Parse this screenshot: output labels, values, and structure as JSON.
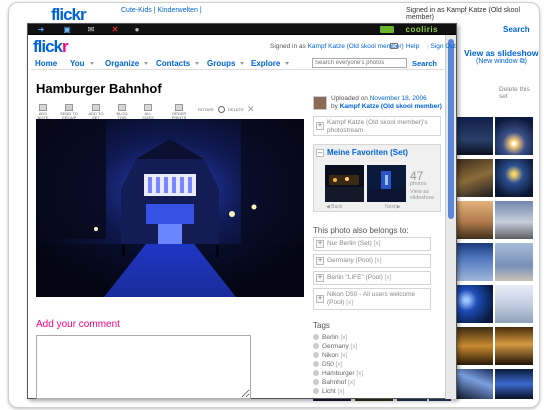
{
  "background_page": {
    "logo": "flickr",
    "breadcrumb": "Cute-Kids | Kinderwelten |",
    "signed_in": "Signed in as Kampf Katze (Old skool member)",
    "search_label": "Search",
    "slideshow_label": "View as slideshow",
    "new_window_label": "(New window ⧉)",
    "delete_set_label": "Delete this set"
  },
  "cooliris": {
    "brand": "cooliris",
    "toolbar_icons": [
      "back-arrow-icon",
      "fullscreen-icon",
      "email-icon",
      "close-icon",
      "lock-icon"
    ]
  },
  "header": {
    "logo_main": "flick",
    "logo_accent": "r",
    "signed_in_prefix": "Signed in as",
    "user_name": "Kampf Katze (Old skool member)",
    "help": "Help",
    "sign_out": "Sign Out"
  },
  "nav": {
    "items": [
      "Home",
      "You",
      "Organize",
      "Contacts",
      "Groups",
      "Explore"
    ],
    "search_placeholder": "Search everyone's photos",
    "search_button": "Search"
  },
  "photo": {
    "title": "Hamburger Bahnhof",
    "toolbar": [
      {
        "label": "ADD NOTE"
      },
      {
        "label": "SEND TO GROUP"
      },
      {
        "label": "ADD TO SET"
      },
      {
        "label": "BLOG THIS"
      },
      {
        "label": "ALL SIZES"
      },
      {
        "label": "ORDER PRINTS"
      },
      {
        "label": "ROTATE"
      },
      {
        "label": "DELETE"
      }
    ]
  },
  "comment": {
    "heading": "Add your comment"
  },
  "sidebar": {
    "uploaded_prefix": "Uploaded on",
    "uploaded_date": "November 18, 2006",
    "by_prefix": "by",
    "uploader": "Kampf Katze (Old skool member)",
    "photostream": "Kampf Katze (Old skool member)'s photostream",
    "favorites": {
      "title": "Meine Favoriten (Set)",
      "count": "47",
      "count_label": "photos",
      "view_as": "View as slideshow",
      "prev": "◀ Back",
      "next": "Next ▶"
    },
    "belongs_heading": "This photo also belongs to:",
    "groups": [
      {
        "label": "Nur Berlin (Set)"
      },
      {
        "label": "Germany (Pool)"
      },
      {
        "label": "Berlin \"LIFE\" (Pool)"
      },
      {
        "label": "Nikon D50 - All users welcome (Pool)"
      }
    ],
    "tags_heading": "Tags",
    "tags": [
      "Berlin",
      "Germany",
      "Nikon",
      "D50",
      "Hamburger",
      "Bahnhof",
      "Licht"
    ],
    "tag_remove": "[x]"
  },
  "colors": {
    "flickr_blue": "#0063dc",
    "flickr_pink": "#ff0084",
    "cooliris_bar": "#111111",
    "cooliris_scroll": "#5b87d6"
  }
}
